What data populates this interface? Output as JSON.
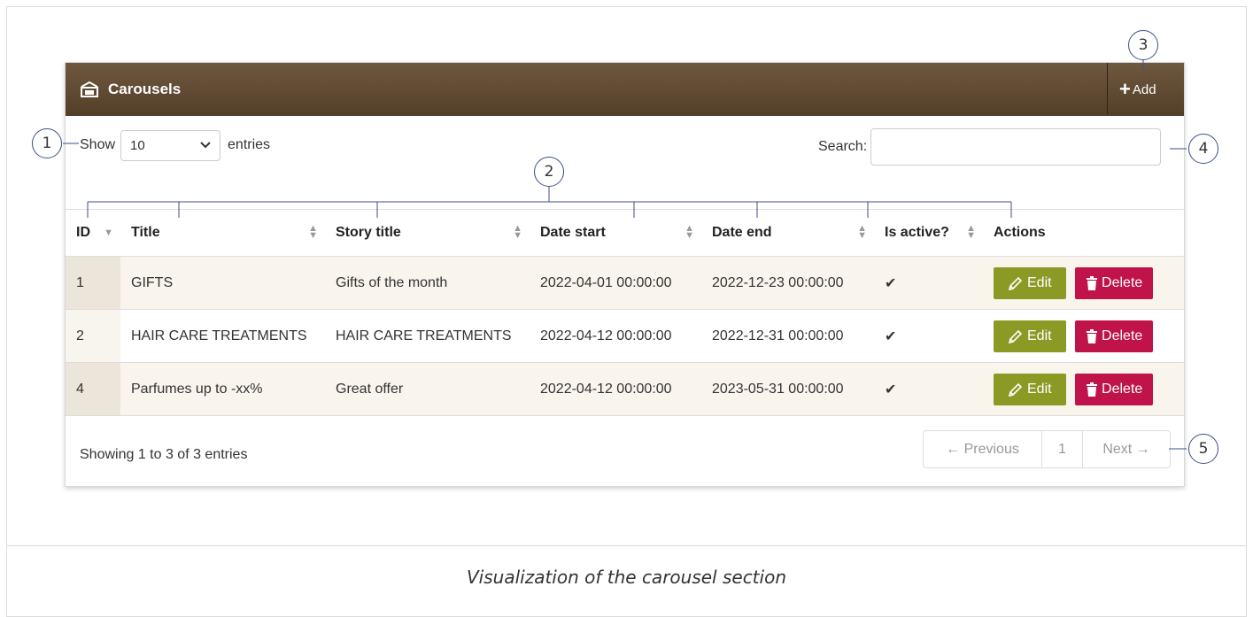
{
  "panel": {
    "title": "Carousels",
    "add_label": "Add"
  },
  "controls": {
    "show_label": "Show",
    "entries_label": "entries",
    "page_size": "10",
    "search_label": "Search:",
    "search_value": ""
  },
  "table": {
    "columns": [
      "ID",
      "Title",
      "Story title",
      "Date start",
      "Date end",
      "Is active?",
      "Actions"
    ],
    "rows": [
      {
        "id": "1",
        "title": "GIFTS",
        "story": "Gifts of the month",
        "start": "2022-04-01 00:00:00",
        "end": "2022-12-23 00:00:00",
        "active": "✔"
      },
      {
        "id": "2",
        "title": "HAIR CARE TREATMENTS",
        "story": "HAIR CARE TREATMENTS",
        "start": "2022-04-12 00:00:00",
        "end": "2022-12-31 00:00:00",
        "active": "✔"
      },
      {
        "id": "4",
        "title": "Parfumes up to -xx%",
        "story": "Great offer",
        "start": "2022-04-12 00:00:00",
        "end": "2023-05-31 00:00:00",
        "active": "✔"
      }
    ],
    "edit_label": "Edit",
    "delete_label": "Delete"
  },
  "footer": {
    "info": "Showing 1 to 3 of 3 entries",
    "prev": "← Previous",
    "page": "1",
    "next": "Next →"
  },
  "callouts": [
    "1",
    "2",
    "3",
    "4",
    "5"
  ],
  "caption": "Visualization of the carousel section",
  "colors": {
    "header": "#5f4a33",
    "edit": "#8b9a25",
    "delete": "#c0134a",
    "callout_border": "#3c4e8a"
  }
}
